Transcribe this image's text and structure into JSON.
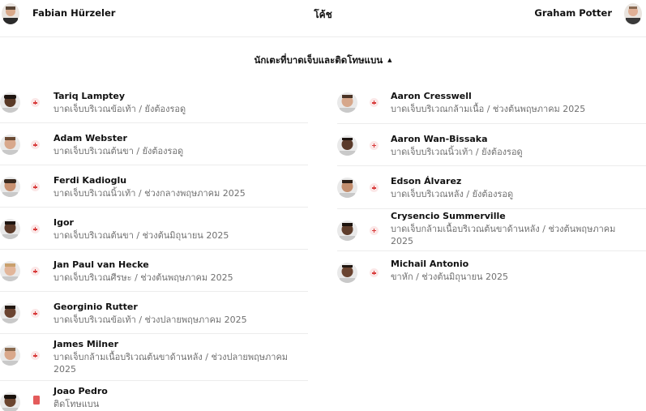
{
  "coaches": {
    "home": "Fabian Hürzeler",
    "title": "โค้ช",
    "away": "Graham Potter"
  },
  "section": {
    "title": "นักเตะที่บาดเจ็บและติดโทษแบน",
    "caret": "▲"
  },
  "home_players": [
    {
      "name": "Tariq Lamptey",
      "detail": "บาดเจ็บบริเวณข้อเท้า / ยังต้องรอดู",
      "status": "injury"
    },
    {
      "name": "Adam Webster",
      "detail": "บาดเจ็บบริเวณต้นขา / ยังต้องรอดู",
      "status": "injury"
    },
    {
      "name": "Ferdi Kadioglu",
      "detail": "บาดเจ็บบริเวณนิ้วเท้า / ช่วงกลางพฤษภาคม 2025",
      "status": "injury"
    },
    {
      "name": "Igor",
      "detail": "บาดเจ็บบริเวณต้นขา / ช่วงต้นมิถุนายน 2025",
      "status": "injury"
    },
    {
      "name": "Jan Paul van Hecke",
      "detail": "บาดเจ็บบริเวณศีรษะ / ช่วงต้นพฤษภาคม 2025",
      "status": "injury"
    },
    {
      "name": "Georginio Rutter",
      "detail": "บาดเจ็บบริเวณข้อเท้า / ช่วงปลายพฤษภาคม 2025",
      "status": "injury"
    },
    {
      "name": "James Milner",
      "detail": "บาดเจ็บกล้ามเนื้อบริเวณต้นขาด้านหลัง / ช่วงปลายพฤษภาคม 2025",
      "status": "injury"
    },
    {
      "name": "Joao Pedro",
      "detail": "ติดโทษแบน",
      "status": "suspension"
    }
  ],
  "away_players": [
    {
      "name": "Aaron Cresswell",
      "detail": "บาดเจ็บบริเวณกล้ามเนื้อ / ช่วงต้นพฤษภาคม 2025",
      "status": "injury"
    },
    {
      "name": "Aaron Wan-Bissaka",
      "detail": "บาดเจ็บบริเวณนิ้วเท้า / ยังต้องรอดู",
      "status": "injury"
    },
    {
      "name": "Edson Álvarez",
      "detail": "บาดเจ็บบริเวณหลัง / ยังต้องรอดู",
      "status": "injury"
    },
    {
      "name": "Crysencio Summerville",
      "detail": "บาดเจ็บกล้ามเนื้อบริเวณต้นขาด้านหลัง / ช่วงต้นพฤษภาคม 2025",
      "status": "injury"
    },
    {
      "name": "Michail Antonio",
      "detail": "ขาหัก / ช่วงต้นมิถุนายน 2025",
      "status": "injury"
    }
  ],
  "colors": {
    "injury_icon": "#d83a3a",
    "suspension_card": "#e45b5b",
    "detail_text": "#707070",
    "divider": "#ececec"
  }
}
